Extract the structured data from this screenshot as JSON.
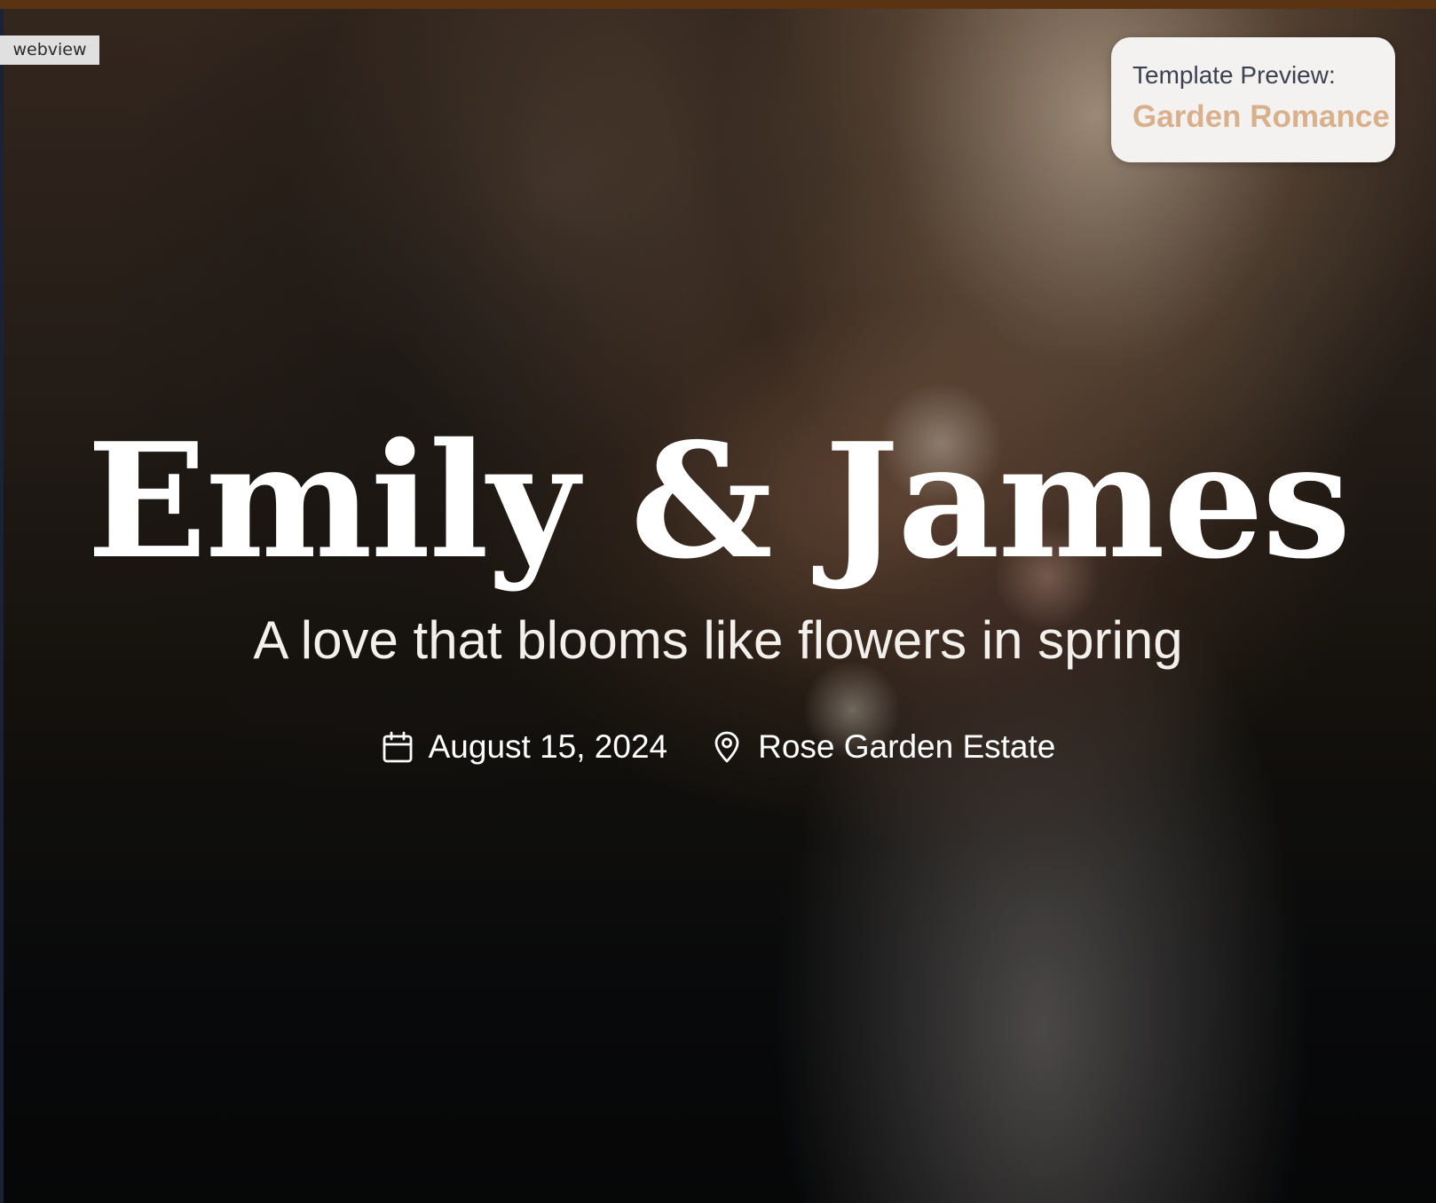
{
  "webview_tag": "webview",
  "template_preview": {
    "label": "Template Preview:",
    "name": "Garden Romance"
  },
  "hero": {
    "names": "Emily & James",
    "tagline": "A love that blooms like flowers in spring",
    "date": "August 15, 2024",
    "location": "Rose Garden Estate",
    "date_icon": "calendar-icon",
    "location_icon": "map-pin-icon"
  },
  "colors": {
    "top_strip": "#5a3412",
    "template_name": "#d9b08c",
    "card_background": "#f4f2f0",
    "hero_text": "#ffffff"
  }
}
